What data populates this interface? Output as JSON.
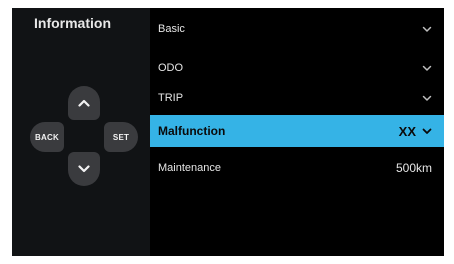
{
  "header": {
    "title": "Information"
  },
  "dpad": {
    "back_label": "BACK",
    "set_label": "SET",
    "up_icon": "chevron-up-icon",
    "down_icon": "chevron-down-icon"
  },
  "menu": {
    "items": [
      {
        "label": "Basic",
        "value": "",
        "icon": "chevron-down-icon",
        "selected": false
      },
      {
        "label": "ODO",
        "value": "",
        "icon": "chevron-down-icon",
        "selected": false
      },
      {
        "label": "TRIP",
        "value": "",
        "icon": "chevron-down-icon",
        "selected": false
      },
      {
        "label": "Malfunction",
        "value": "XX",
        "icon": "chevron-down-icon",
        "selected": true
      },
      {
        "label": "Maintenance",
        "value": "500km",
        "icon": "",
        "selected": false
      }
    ]
  },
  "colors": {
    "accent": "#35b3e6",
    "background": "#000000",
    "panel": "#111315",
    "button": "#3a3b3e"
  }
}
